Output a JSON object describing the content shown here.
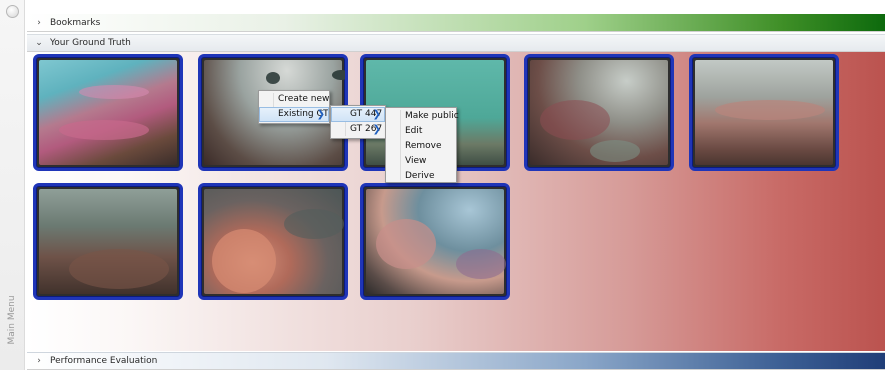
{
  "sidebar": {
    "label": "Main Menu",
    "knob_icon": "menu-knob-icon"
  },
  "sections": {
    "bookmarks": {
      "label": "Bookmarks",
      "expanded": false
    },
    "ground_truth": {
      "label": "Your Ground Truth",
      "expanded": true
    },
    "performance": {
      "label": "Performance Evaluation",
      "expanded": false
    }
  },
  "thumbnails": [
    {
      "id": "coral-image-1"
    },
    {
      "id": "coral-image-2"
    },
    {
      "id": "coral-image-3"
    },
    {
      "id": "coral-image-4"
    },
    {
      "id": "coral-image-5"
    },
    {
      "id": "coral-image-6"
    },
    {
      "id": "coral-image-7"
    },
    {
      "id": "coral-image-8"
    }
  ],
  "context_menu": {
    "items": [
      {
        "label": "Create new"
      },
      {
        "label": "Existing GT",
        "has_submenu": true,
        "highlighted": true
      }
    ]
  },
  "gt_submenu": {
    "items": [
      {
        "label": "GT 447",
        "has_submenu": true,
        "highlighted": true
      },
      {
        "label": "GT 267",
        "has_submenu": true
      }
    ]
  },
  "action_submenu": {
    "items": [
      {
        "label": "Make public"
      },
      {
        "label": "Edit"
      },
      {
        "label": "Remove"
      },
      {
        "label": "View"
      },
      {
        "label": "Derive"
      }
    ]
  },
  "colors": {
    "thumb_border": "#1f35b8",
    "bookmarks_accent": "#0d6a0d",
    "performance_accent": "#203e78",
    "content_accent": "#bb534f"
  },
  "icons": {
    "collapsed": "›",
    "expanded": "⌄",
    "submenu": "❯"
  }
}
